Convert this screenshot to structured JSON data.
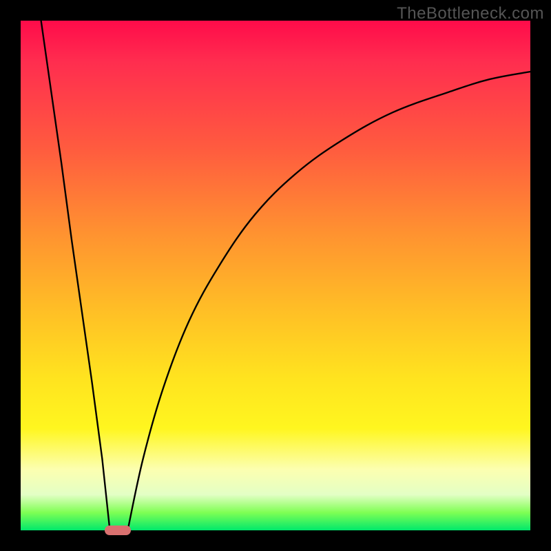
{
  "watermark": "TheBottleneck.com",
  "chart_data": {
    "type": "line",
    "title": "",
    "xlabel": "",
    "ylabel": "",
    "xlim": [
      0,
      100
    ],
    "ylim": [
      0,
      100
    ],
    "grid": false,
    "background_gradient": {
      "orientation": "vertical",
      "stops": [
        {
          "pos": 0,
          "color": "#ff0b4a",
          "meaning": "severe-bottleneck"
        },
        {
          "pos": 50,
          "color": "#ffb526",
          "meaning": "moderate"
        },
        {
          "pos": 80,
          "color": "#fff61f",
          "meaning": "mild"
        },
        {
          "pos": 100,
          "color": "#00e86b",
          "meaning": "no-bottleneck"
        }
      ]
    },
    "series": [
      {
        "name": "left-branch",
        "description": "steep linear descent from top-left to the notch",
        "x": [
          4,
          6,
          8,
          10,
          12,
          14,
          16,
          17.5
        ],
        "y": [
          100,
          86,
          72,
          57,
          43,
          29,
          14,
          0
        ]
      },
      {
        "name": "right-branch",
        "description": "ascending decelerating curve from notch toward upper-right",
        "x": [
          21,
          24,
          28,
          33,
          39,
          46,
          54,
          63,
          73,
          84,
          92,
          100
        ],
        "y": [
          0,
          14,
          28,
          41,
          52,
          62,
          70,
          76.5,
          82,
          86,
          88.5,
          90
        ]
      }
    ],
    "marker": {
      "name": "optimal-point",
      "x": 19,
      "y": 0,
      "color": "#d9706f"
    }
  }
}
